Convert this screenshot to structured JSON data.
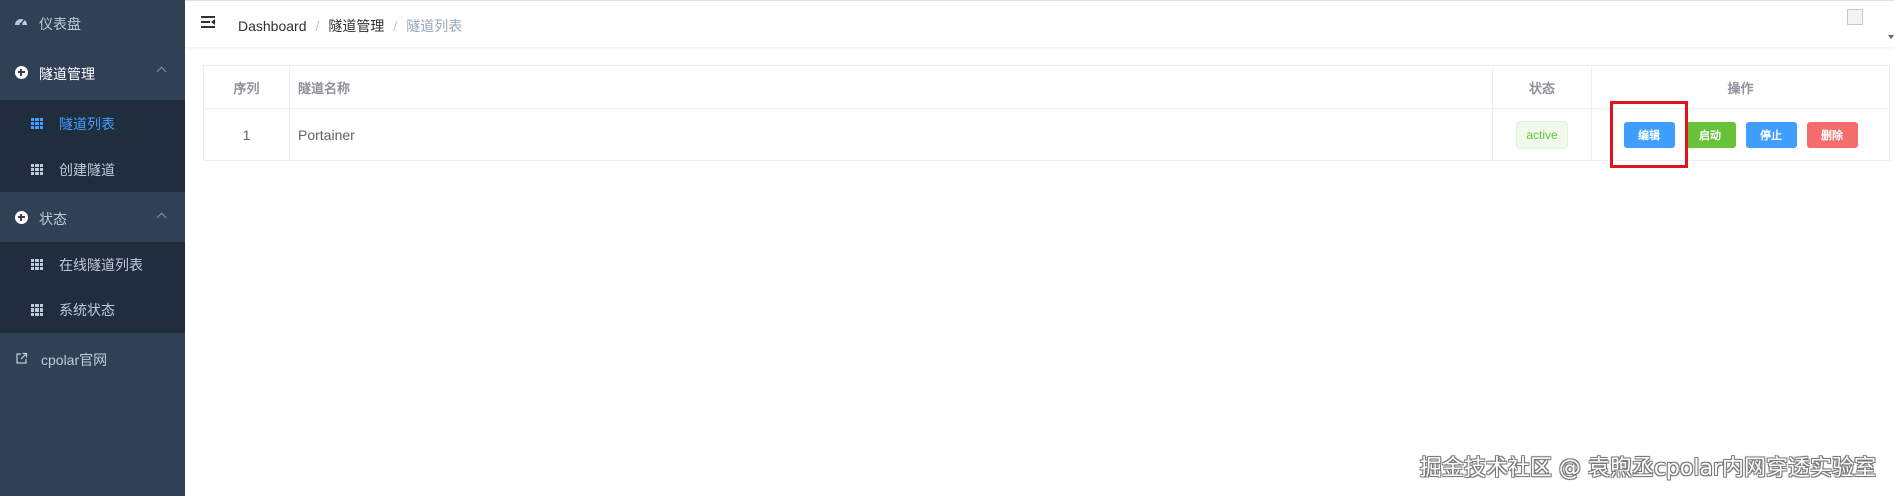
{
  "sidebar": {
    "dashboard": {
      "label": "仪表盘",
      "icon": "dashboard-icon"
    },
    "tunnel_mgmt": {
      "label": "隧道管理",
      "icon": "plus-circle-icon",
      "expanded": true,
      "items": [
        {
          "label": "隧道列表",
          "icon": "grid-icon",
          "active": true
        },
        {
          "label": "创建隧道",
          "icon": "grid-icon",
          "active": false
        }
      ]
    },
    "status": {
      "label": "状态",
      "icon": "plus-circle-icon",
      "expanded": true,
      "items": [
        {
          "label": "在线隧道列表",
          "icon": "grid-icon"
        },
        {
          "label": "系统状态",
          "icon": "grid-icon"
        }
      ]
    },
    "cpolar_site": {
      "label": "cpolar官网",
      "icon": "external-link-icon"
    }
  },
  "navbar": {
    "breadcrumb": [
      "Dashboard",
      "隧道管理",
      "隧道列表"
    ]
  },
  "table": {
    "headers": [
      "序列",
      "隧道名称",
      "状态",
      "操作"
    ],
    "rows": [
      {
        "index": "1",
        "name": "Portainer",
        "status": "active",
        "actions": [
          "编辑",
          "启动",
          "停止",
          "删除"
        ]
      }
    ]
  },
  "watermark": "掘金技术社区 @ 袁煦丞cpolar内网穿透实验室",
  "colors": {
    "sidebar_bg": "#304156",
    "submenu_bg": "#1f2d3d",
    "accent": "#409eff",
    "success": "#67c23a",
    "danger": "#f56c6c",
    "highlight_box": "#e0141b"
  }
}
